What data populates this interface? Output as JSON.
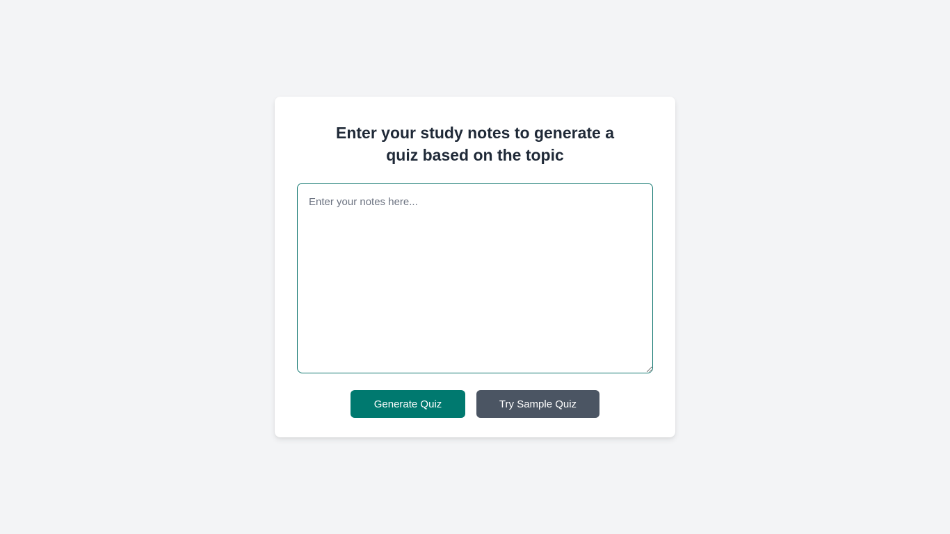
{
  "form": {
    "heading": "Enter your study notes to generate a quiz based on the topic",
    "notes_placeholder": "Enter your notes here...",
    "notes_value": "",
    "generate_label": "Generate Quiz",
    "sample_label": "Try Sample Quiz"
  },
  "colors": {
    "primary": "#00796f",
    "secondary": "#4b5563"
  }
}
